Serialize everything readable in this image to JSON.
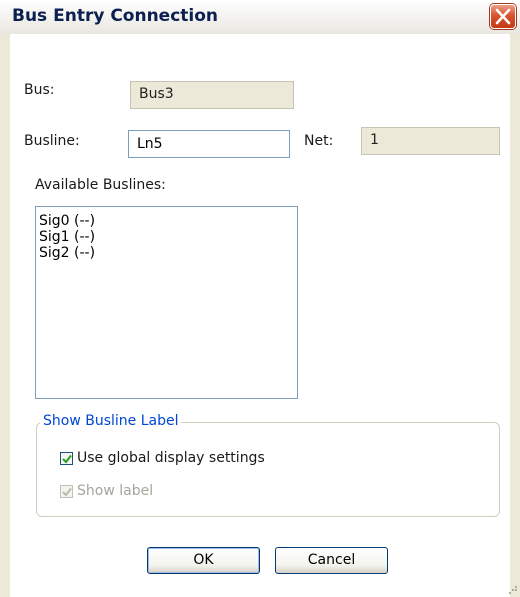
{
  "window": {
    "title": "Bus Entry Connection"
  },
  "bus": {
    "label": "Bus:",
    "value": "Bus3"
  },
  "busline": {
    "label": "Busline:",
    "value": "Ln5"
  },
  "net": {
    "label": "Net:",
    "value": "1"
  },
  "available_buslines": {
    "label": "Available Buslines:",
    "items": [
      {
        "label": "Sig0 (--)"
      },
      {
        "label": "Sig1 (--)"
      },
      {
        "label": "Sig2 (--)"
      }
    ]
  },
  "show_busline_label": {
    "legend": "Show Busline Label",
    "use_global": {
      "label": "Use global display settings",
      "checked": true,
      "enabled": true
    },
    "show_label": {
      "label": "Show label",
      "checked": true,
      "enabled": false
    }
  },
  "buttons": {
    "ok": "OK",
    "cancel": "Cancel"
  },
  "colors": {
    "title_text": "#0b1f50",
    "legend_text": "#0046d5",
    "close_button": "#d9532f",
    "dialog_face": "#ece9d8"
  }
}
